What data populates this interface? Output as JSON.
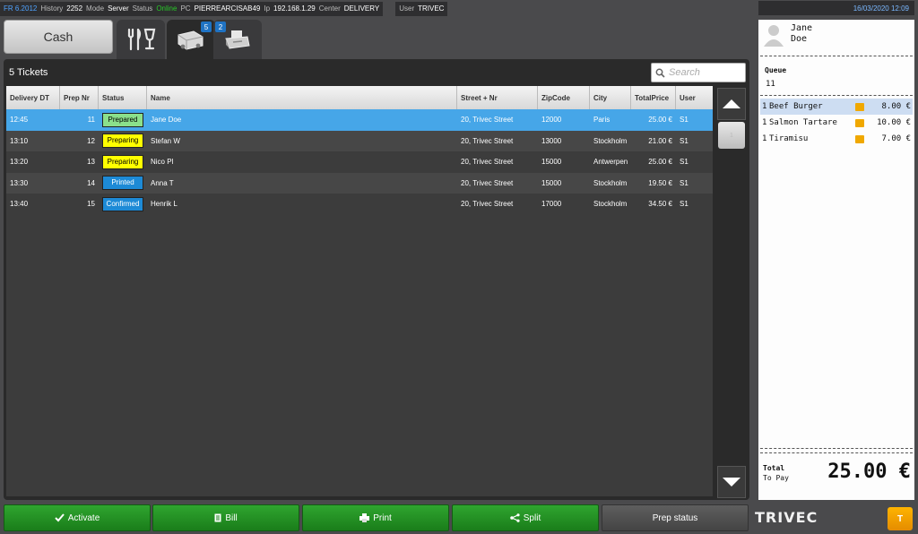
{
  "topbar": {
    "version": "FR 6.2012",
    "history_label": "History",
    "history_value": "2252",
    "mode_label": "Mode",
    "mode_value": "Server",
    "status_label": "Status",
    "status_value": "Online",
    "pc_label": "PC",
    "pc_value": "PIERREARCISAB49",
    "ip_label": "Ip",
    "ip_value": "192.168.1.29",
    "center_label": "Center",
    "center_value": "DELIVERY",
    "user_label": "User",
    "user_value": "TRIVEC",
    "datetime": "16/03/2020 12:09"
  },
  "tabs": {
    "cash_label": "Cash",
    "delivery_badge": "5",
    "printer_badge": "2"
  },
  "tickets": {
    "title": "5 Tickets",
    "search_placeholder": "Search",
    "columns": [
      "Delivery DT",
      "Prep Nr",
      "Status",
      "Name",
      "Street + Nr",
      "ZipCode",
      "City",
      "TotalPrice",
      "User"
    ],
    "rows": [
      {
        "dt": "12:45",
        "prep": "11",
        "status": "Prepared",
        "name": "Jane Doe",
        "street": "20, Trivec Street",
        "zip": "12000",
        "city": "Paris",
        "price": "25.00 €",
        "user": "S1"
      },
      {
        "dt": "13:10",
        "prep": "12",
        "status": "Preparing",
        "name": "Stefan W",
        "street": "20, Trivec Street",
        "zip": "13000",
        "city": "Stockholm",
        "price": "21.00 €",
        "user": "S1"
      },
      {
        "dt": "13:20",
        "prep": "13",
        "status": "Preparing",
        "name": "Nico Pl",
        "street": "20, Trivec Street",
        "zip": "15000",
        "city": "Antwerpen",
        "price": "25.00 €",
        "user": "S1"
      },
      {
        "dt": "13:30",
        "prep": "14",
        "status": "Printed",
        "name": "Anna T",
        "street": "20, Trivec Street",
        "zip": "15000",
        "city": "Stockholm",
        "price": "19.50 €",
        "user": "S1"
      },
      {
        "dt": "13:40",
        "prep": "15",
        "status": "Confirmed",
        "name": "Henrik L",
        "street": "20, Trivec Street",
        "zip": "17000",
        "city": "Stockholm",
        "price": "34.50 €",
        "user": "S1"
      }
    ],
    "scroll_page": "1"
  },
  "status_colors": {
    "Prepared": "#8be08b",
    "Preparing": "#ffff00",
    "Printed": "#1d8ad6",
    "Confirmed": "#1d8ad6"
  },
  "buttons": {
    "activate": "Activate",
    "bill": "Bill",
    "print": "Print",
    "split": "Split",
    "prep_status": "Prep status"
  },
  "receipt": {
    "first_name": "Jane",
    "last_name": "Doe",
    "queue_label": "Queue",
    "queue_value": "11",
    "items": [
      {
        "qty": "1",
        "name": "Beef Burger",
        "price": "8.00 €"
      },
      {
        "qty": "1",
        "name": "Salmon Tartare",
        "price": "10.00 €"
      },
      {
        "qty": "1",
        "name": "Tiramisu",
        "price": "7.00 €"
      }
    ],
    "total_label": "Total",
    "to_pay_label": "To Pay",
    "total_value": "25.00 €"
  },
  "brand": {
    "name": "TRIVEC",
    "button": "T"
  }
}
